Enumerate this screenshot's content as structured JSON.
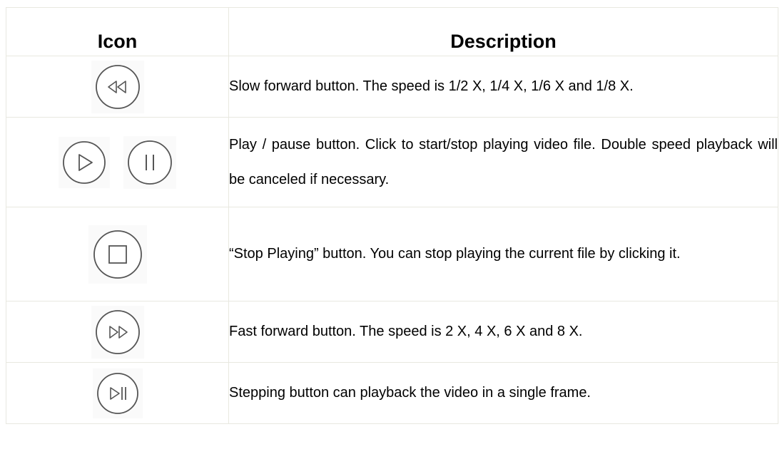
{
  "table": {
    "headers": {
      "icon": "Icon",
      "description": "Description"
    },
    "rows": [
      {
        "icons": [
          "slow-forward-icon"
        ],
        "description": "Slow forward button. The speed is 1/2 X, 1/4 X, 1/6 X and 1/8 X."
      },
      {
        "icons": [
          "play-icon",
          "pause-icon"
        ],
        "description": "Play / pause button. Click to start/stop playing video file. Double speed playback will be canceled if necessary."
      },
      {
        "icons": [
          "stop-icon"
        ],
        "description": "“Stop Playing” button. You can stop playing the current file by clicking it."
      },
      {
        "icons": [
          "fast-forward-icon"
        ],
        "description": "Fast forward button. The speed is 2 X, 4 X, 6 X and 8 X."
      },
      {
        "icons": [
          "step-frame-icon"
        ],
        "description": "Stepping button can playback the video in a single frame."
      }
    ]
  }
}
